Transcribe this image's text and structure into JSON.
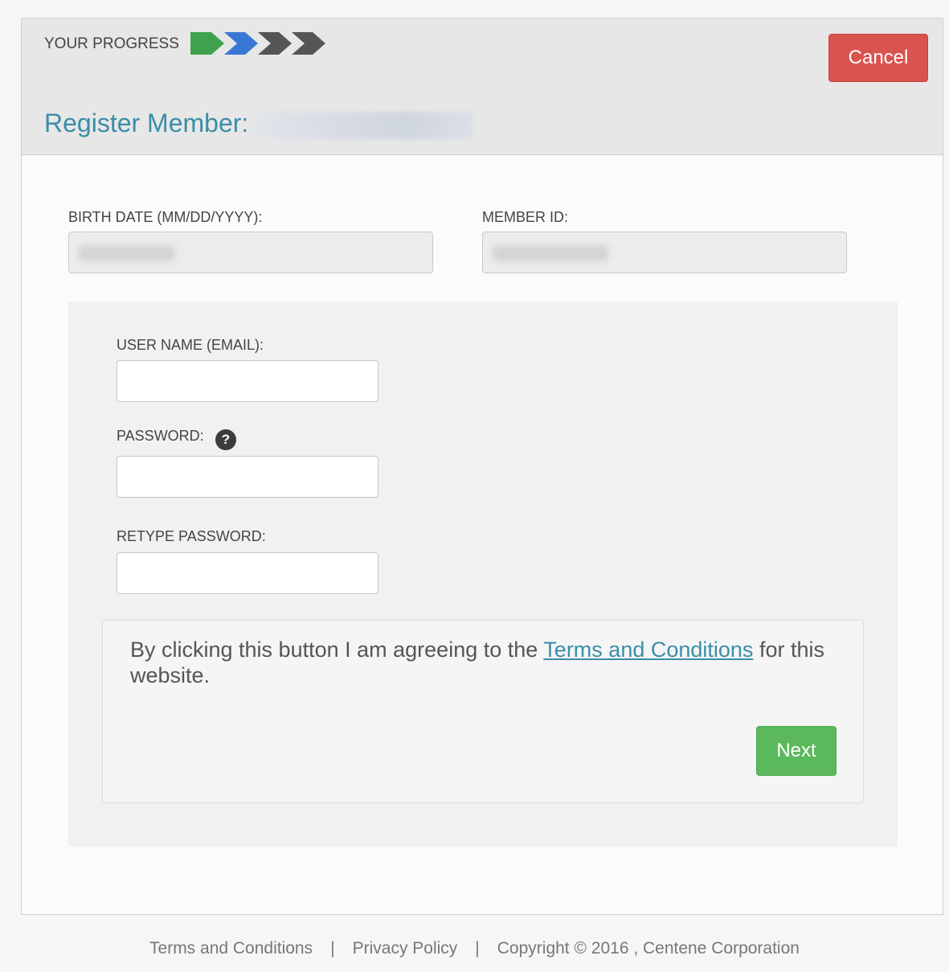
{
  "progress": {
    "label": "YOUR PROGRESS",
    "steps": [
      "complete",
      "current",
      "pending",
      "pending"
    ],
    "colors": {
      "complete": "#3fa34d",
      "current": "#3a78d6",
      "pending": "#555555"
    }
  },
  "header": {
    "cancel_label": "Cancel",
    "title": "Register Member:"
  },
  "fields": {
    "birth_date_label": "BIRTH DATE (MM/DD/YYYY):",
    "member_id_label": "MEMBER ID:",
    "username_label": "USER NAME (EMAIL):",
    "password_label": "PASSWORD:",
    "retype_password_label": "RETYPE PASSWORD:"
  },
  "agreement": {
    "text_before": "By clicking this button I am agreeing to the ",
    "link_text": "Terms and Conditions",
    "text_after": " for this website."
  },
  "buttons": {
    "next_label": "Next"
  },
  "footer": {
    "terms": "Terms and Conditions",
    "separator": "|",
    "privacy": "Privacy Policy",
    "copyright": "Copyright © 2016 , Centene Corporation"
  },
  "colors": {
    "accent": "#3a8ea8",
    "cancel": "#d9534f",
    "next": "#5cb85c"
  }
}
